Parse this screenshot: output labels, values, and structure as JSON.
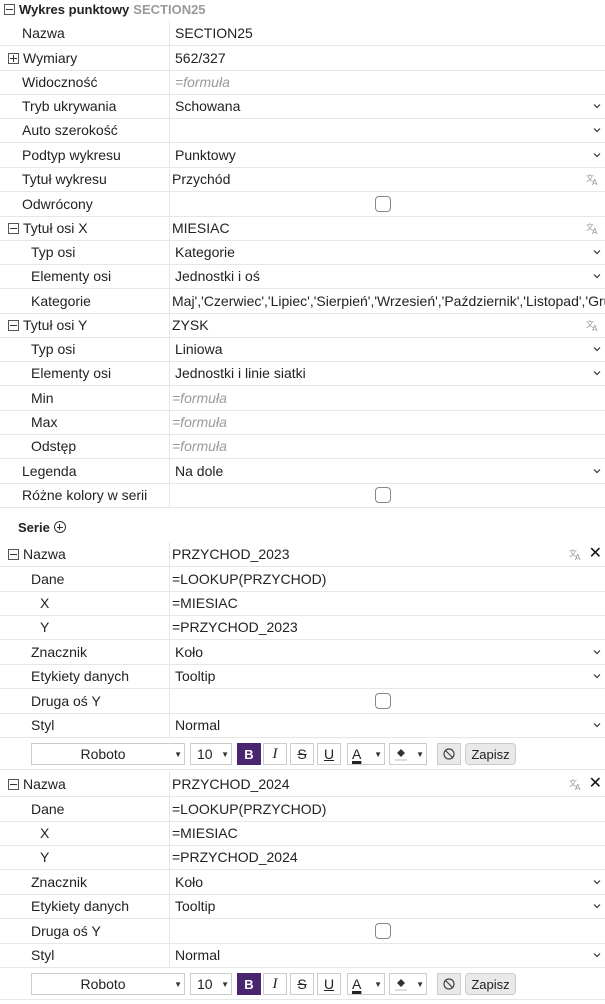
{
  "section": {
    "title": "Wykres punktowy",
    "subtitle": "SECTION25"
  },
  "rows": {
    "nazwa": {
      "label": "Nazwa",
      "value": "SECTION25"
    },
    "wymiary": {
      "label": "Wymiary",
      "value": "562/327"
    },
    "widocznosc": {
      "label": "Widoczność",
      "placeholder": "=formuła"
    },
    "tryb": {
      "label": "Tryb ukrywania",
      "value": "Schowana"
    },
    "auto": {
      "label": "Auto szerokość",
      "value": ""
    },
    "podtyp": {
      "label": "Podtyp wykresu",
      "value": "Punktowy"
    },
    "tytul": {
      "label": "Tytuł wykresu",
      "value": "Przychód"
    },
    "odwrocony": {
      "label": "Odwrócony"
    },
    "osx": {
      "label": "Tytuł osi X",
      "value": "MIESIAC"
    },
    "osx_typ": {
      "label": "Typ osi",
      "value": "Kategorie"
    },
    "osx_el": {
      "label": "Elementy osi",
      "value": "Jednostki i oś"
    },
    "osx_kat": {
      "label": "Kategorie",
      "value": "Maj','Czerwiec','Lipiec','Sierpień','Wrzesień','Październik','Listopad','Grudz"
    },
    "osy": {
      "label": "Tytuł osi Y",
      "value": "ZYSK"
    },
    "osy_typ": {
      "label": "Typ osi",
      "value": "Liniowa"
    },
    "osy_el": {
      "label": "Elementy osi",
      "value": "Jednostki i linie siatki"
    },
    "min": {
      "label": "Min",
      "placeholder": "=formuła"
    },
    "max": {
      "label": "Max",
      "placeholder": "=formuła"
    },
    "odstep": {
      "label": "Odstęp",
      "placeholder": "=formuła"
    },
    "legenda": {
      "label": "Legenda",
      "value": "Na dole"
    },
    "rozne": {
      "label": "Różne kolory w serii"
    }
  },
  "serie_label": "Serie",
  "series": [
    {
      "nazwa_label": "Nazwa",
      "nazwa": "PRZYCHOD_2023",
      "dane_label": "Dane",
      "dane": "=LOOKUP(PRZYCHOD)",
      "x_label": "X",
      "x": "=MIESIAC",
      "y_label": "Y",
      "y": "=PRZYCHOD_2023",
      "znacznik_label": "Znacznik",
      "znacznik": "Koło",
      "etykiety_label": "Etykiety danych",
      "etykiety": "Tooltip",
      "druga_label": "Druga oś Y",
      "styl_label": "Styl",
      "styl": "Normal",
      "toolbar": {
        "font": "Roboto",
        "size": "10",
        "bold": "B",
        "italic": "I",
        "strike": "S",
        "underline": "U",
        "text_color": "A",
        "save": "Zapisz"
      }
    },
    {
      "nazwa_label": "Nazwa",
      "nazwa": "PRZYCHOD_2024",
      "dane_label": "Dane",
      "dane": "=LOOKUP(PRZYCHOD)",
      "x_label": "X",
      "x": "=MIESIAC",
      "y_label": "Y",
      "y": "=PRZYCHOD_2024",
      "znacznik_label": "Znacznik",
      "znacznik": "Koło",
      "etykiety_label": "Etykiety danych",
      "etykiety": "Tooltip",
      "druga_label": "Druga oś Y",
      "styl_label": "Styl",
      "styl": "Normal",
      "toolbar": {
        "font": "Roboto",
        "size": "10",
        "bold": "B",
        "italic": "I",
        "strike": "S",
        "underline": "U",
        "text_color": "A",
        "save": "Zapisz"
      }
    }
  ],
  "colors": {
    "accent": "#4a2670",
    "border": "#e6e6e6",
    "placeholder": "#9a9a9a"
  }
}
